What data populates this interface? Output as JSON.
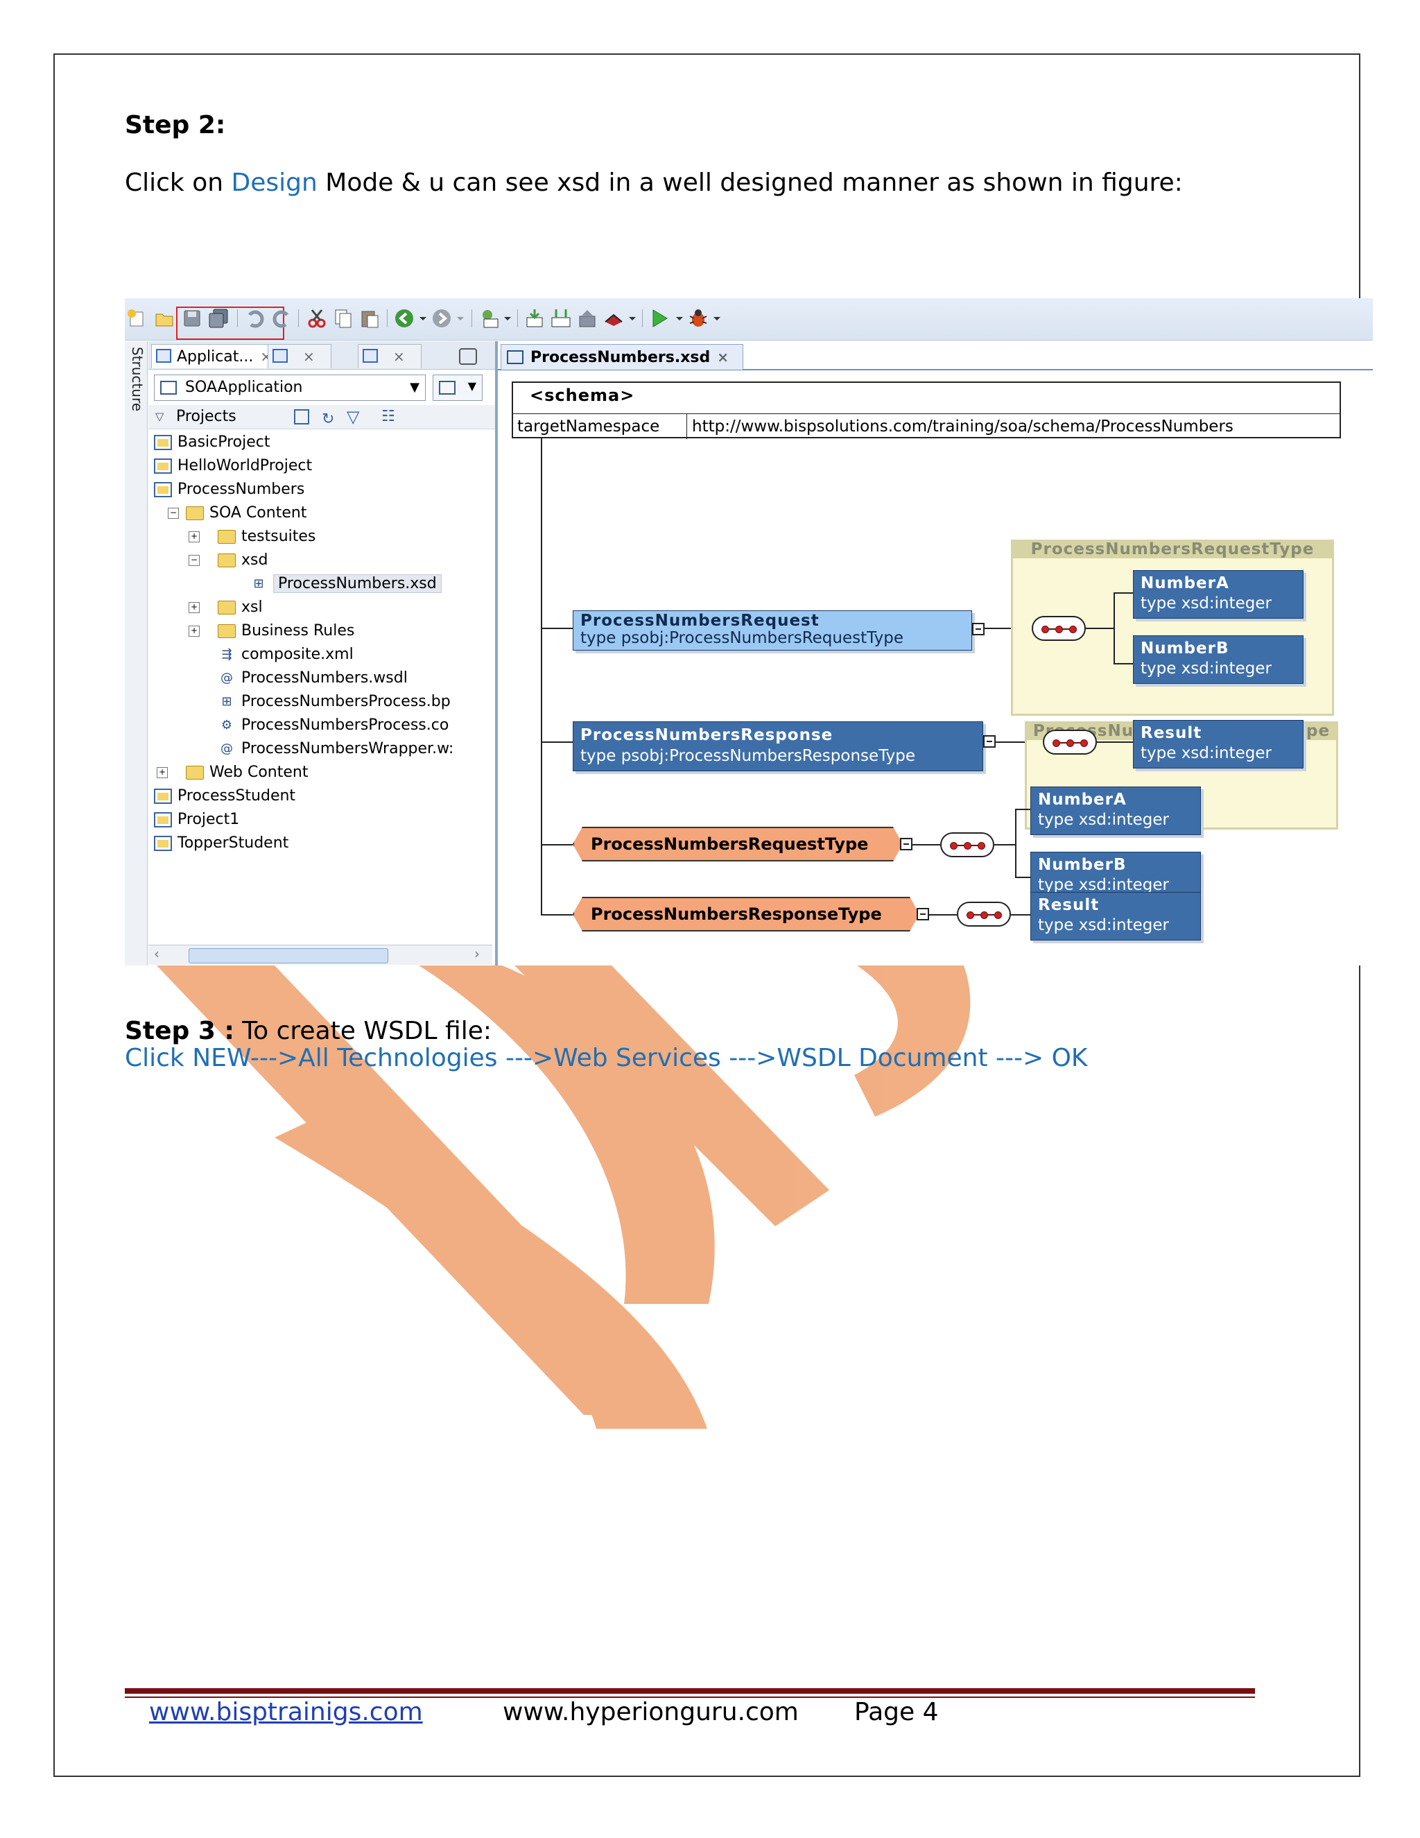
{
  "step2": {
    "heading": "Step 2:",
    "text_before": "Click on ",
    "design_word": "Design",
    "text_after": " Mode  & u can see xsd  in a well designed manner as shown in figure:"
  },
  "screenshot": {
    "toolbar_icons": [
      "new-icon",
      "open-icon",
      "save-icon",
      "save-all-icon",
      "undo-icon",
      "redo-icon",
      "cut-icon",
      "copy-icon",
      "paste-icon",
      "back-icon",
      "forward-icon",
      "sql-icon",
      "make-icon",
      "rebuild-icon",
      "deploy-icon",
      "debug-icon",
      "run-icon",
      "bug-icon"
    ],
    "structure_label": "Structure",
    "left_tabs": {
      "tab1": "Applicat...",
      "close": "×"
    },
    "app_combo": "SOAApplication",
    "projects_label": "Projects",
    "tree": [
      {
        "label": "BasicProject"
      },
      {
        "label": "HelloWorldProject"
      },
      {
        "label": "ProcessNumbers"
      },
      {
        "label": "SOA Content"
      },
      {
        "label": "testsuites"
      },
      {
        "label": "xsd"
      },
      {
        "label": "ProcessNumbers.xsd"
      },
      {
        "label": "xsl"
      },
      {
        "label": "Business Rules"
      },
      {
        "label": "composite.xml"
      },
      {
        "label": "ProcessNumbers.wsdl"
      },
      {
        "label": "ProcessNumbersProcess.bp"
      },
      {
        "label": "ProcessNumbersProcess.co"
      },
      {
        "label": "ProcessNumbersWrapper.w:"
      },
      {
        "label": "Web Content"
      },
      {
        "label": "ProcessStudent"
      },
      {
        "label": "Project1"
      },
      {
        "label": "TopperStudent"
      }
    ],
    "editor_tab": "ProcessNumbers.xsd",
    "editor_tab_close": "×",
    "schema": {
      "title": "<schema>",
      "tn_label": "targetNamespace",
      "tn_value": "http://www.bispsolutions.com/training/soa/schema/ProcessNumbers"
    },
    "elements": {
      "request": {
        "name": "ProcessNumbersRequest",
        "type": "type psobj:ProcessNumbersRequestType"
      },
      "response": {
        "name": "ProcessNumbersResponse",
        "type": "type psobj:ProcessNumbersResponseType"
      }
    },
    "groups": {
      "request_type_title": "ProcessNumbersRequestType",
      "response_type_title": "ProcessNumbersResponseType"
    },
    "complex_types": {
      "request": "ProcessNumbersRequestType",
      "response": "ProcessNumbersResponseType"
    },
    "fields": {
      "a": {
        "name": "NumberA",
        "type": "type xsd:integer"
      },
      "b": {
        "name": "NumberB",
        "type": "type xsd:integer"
      },
      "result": {
        "name": "Result",
        "type": "type xsd:integer"
      }
    }
  },
  "step3": {
    "heading": "Step 3 :",
    "text": " To create WSDL file:",
    "link_line": "Click NEW--->All Technologies --->Web Services --->WSDL Document ---> OK"
  },
  "footer": {
    "link1": "www.bisptrainigs.com",
    "site2": "www.hyperionguru.com",
    "page": "Page 4"
  },
  "colors": {
    "link_blue": "#1f6fb5",
    "footer_rule": "#7a0d12",
    "watermark": "#f0a878",
    "element_dark": "#3d6ea8",
    "element_light": "#9cc9f3",
    "complex_type": "#f4a57a"
  }
}
